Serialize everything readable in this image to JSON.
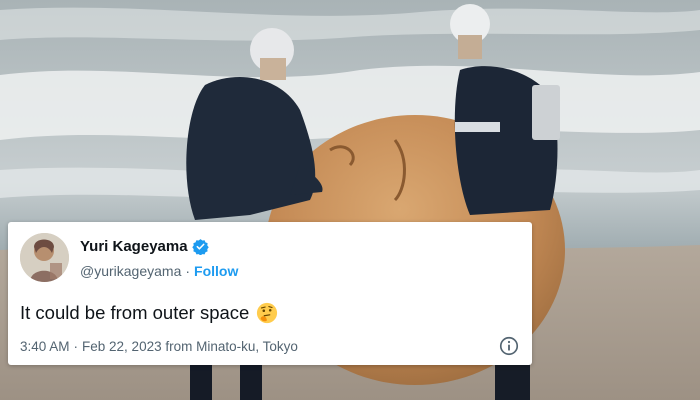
{
  "tweet": {
    "display_name": "Yuri Kageyama",
    "handle": "@yurikageyama",
    "separator": "·",
    "follow_label": "Follow",
    "text": "It could be from outer space",
    "time": "3:40 AM",
    "date_sep": "·",
    "date": "Feb 22, 2023 from Minato-ku, Tokyo"
  },
  "icons": {
    "verified": "verified-badge-icon",
    "emoji": "thinking-face-icon",
    "info": "info-icon"
  },
  "colors": {
    "accent": "#1d9bf0",
    "text": "#0f1419",
    "secondary": "#536471"
  }
}
